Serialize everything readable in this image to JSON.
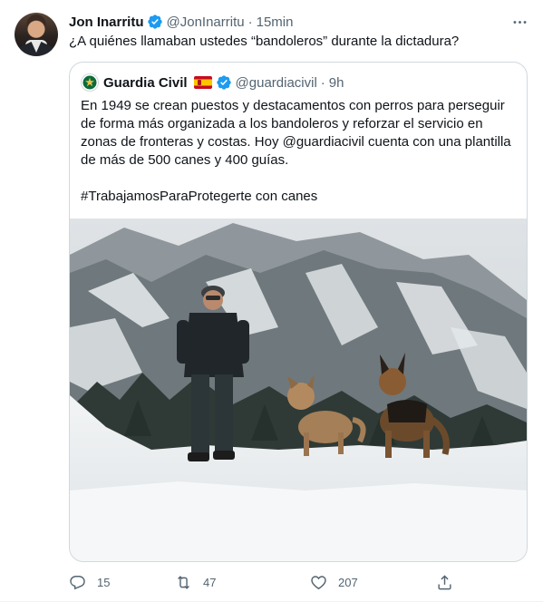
{
  "tweet": {
    "author_name": "Jon Inarritu",
    "author_handle": "@JonInarritu",
    "separator": "·",
    "time": "15min",
    "text": "¿A quiénes llamaban ustedes “bandoleros” durante la dictadura?",
    "more_icon": "more-horizontal-icon"
  },
  "quoted": {
    "author_name": "Guardia Civil",
    "author_handle": "@guardiacivil",
    "separator": "·",
    "time": "9h",
    "paragraph1": "En 1949 se crean puestos y destacamentos con perros para perseguir de forma más organizada a los bandoleros y reforzar el servicio en zonas de fronteras y costas. Hoy @guardiacivil cuenta con una plantilla de más de 500 canes y 400 guías.",
    "paragraph2": "#TrabajamosParaProtegerte con canes",
    "flag_icon": "spain-flag-icon",
    "image_alt": "Guardia civil con dos perros sobre la nieve en montaña"
  },
  "actions": {
    "replies": "15",
    "retweets": "47",
    "likes": "207"
  },
  "colors": {
    "text": "#0f1419",
    "secondary": "#536471",
    "verified": "#1d9bf0",
    "border": "#cfd9de"
  }
}
